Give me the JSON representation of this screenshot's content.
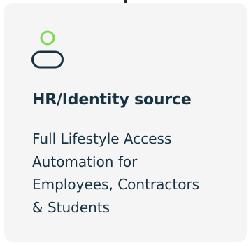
{
  "card": {
    "icon": "person-icon",
    "title": "HR/Identity source",
    "description_lines": [
      "Full Lifestyle Access",
      "Automation for",
      "Employees, Contractors",
      "& Students"
    ]
  },
  "colors": {
    "card_background": "#f5f5f6",
    "text": "#173242",
    "icon_head": "#7ed957",
    "icon_body": "#173242"
  }
}
